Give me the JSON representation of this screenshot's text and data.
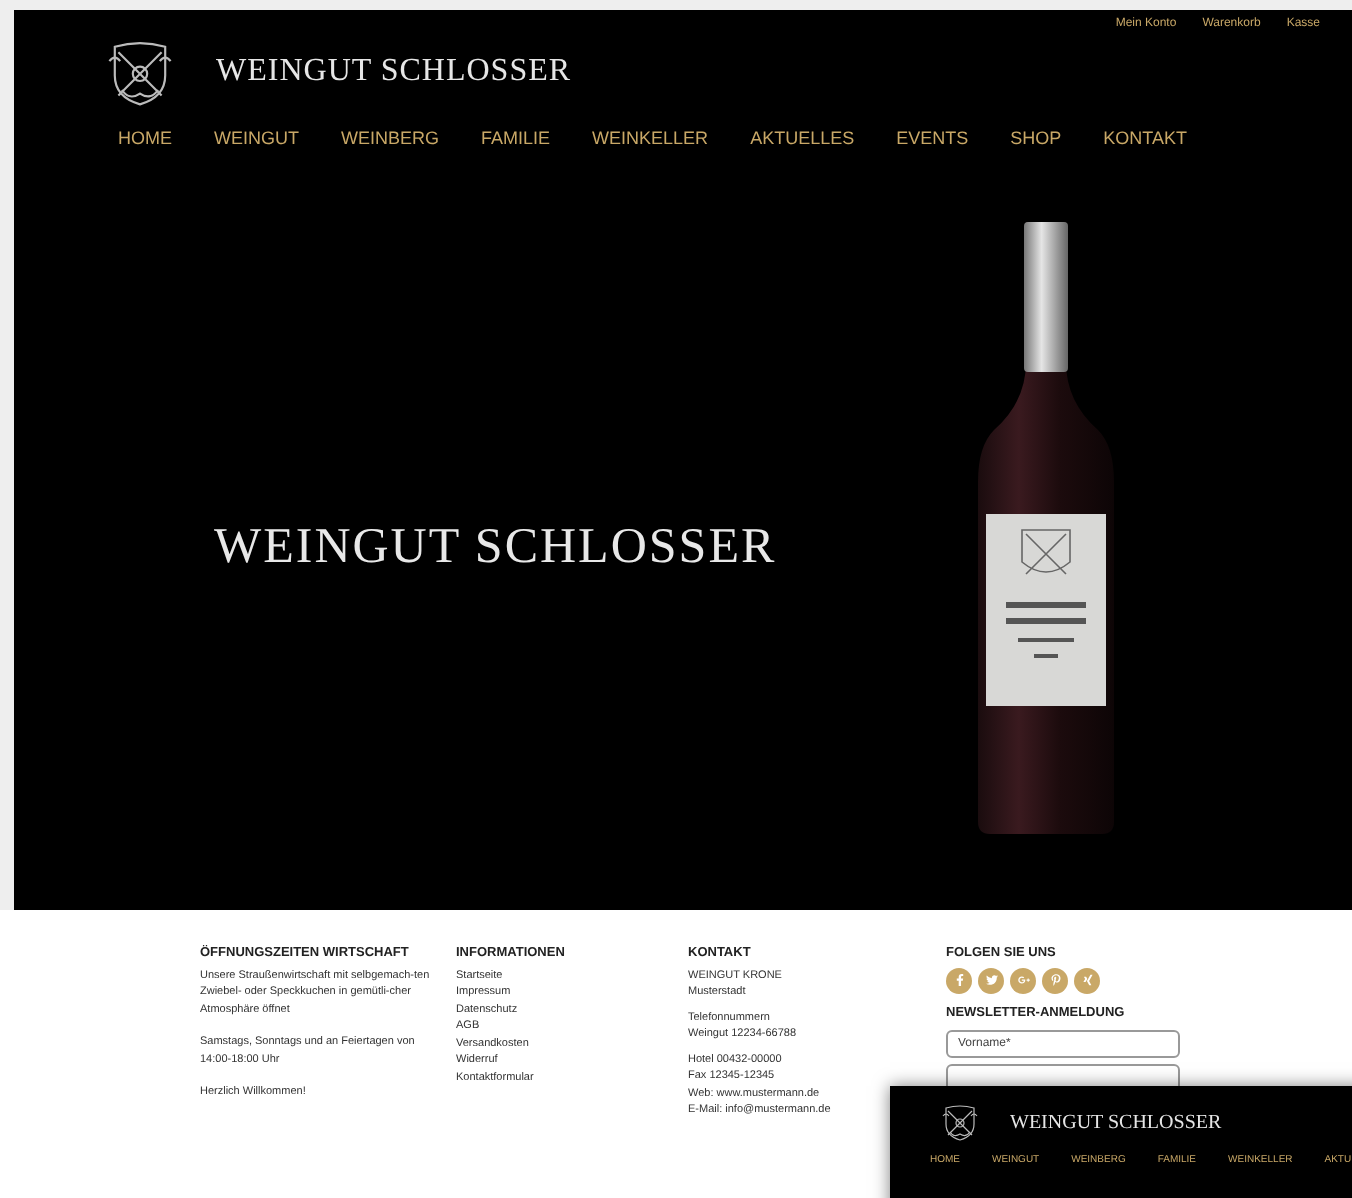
{
  "top_links": [
    "Mein Konto",
    "Warenkorb",
    "Kasse"
  ],
  "brand": "WEINGUT SCHLOSSER",
  "nav": [
    {
      "label": "HOME"
    },
    {
      "label": "WEINGUT"
    },
    {
      "label": "WEINBERG"
    },
    {
      "label": "FAMILIE"
    },
    {
      "label": "WEINKELLER"
    },
    {
      "label": "AKTUELLES"
    },
    {
      "label": "EVENTS"
    },
    {
      "label": "SHOP"
    },
    {
      "label": "KONTAKT"
    }
  ],
  "hero": {
    "title": "WEINGUT SCHLOSSER"
  },
  "footer": {
    "hours": {
      "heading": "ÖFFNUNGSZEITEN WIRTSCHAFT",
      "paragraphs": [
        "Unsere Straußenwirtschaft mit selbgemach-ten Zwiebel- oder Speckkuchen in gemütli-cher Atmosphäre öffnet",
        "Samstags, Sonntags und an Feiertagen von 14:00-18:00 Uhr",
        "Herzlich Willkommen!"
      ]
    },
    "info": {
      "heading": "INFORMATIONEN",
      "links": [
        "Startseite",
        "Impressum",
        "Datenschutz",
        "AGB",
        "Versandkosten",
        "Widerruf",
        "Kontaktformular"
      ]
    },
    "contact": {
      "heading": "KONTAKT",
      "groups": [
        [
          "WEINGUT KRONE",
          "Musterstadt"
        ],
        [
          "Telefonnummern",
          "Weingut 12234-66788"
        ],
        [
          "Hotel 00432-00000",
          "Fax 12345-12345",
          "Web: www.mustermann.de",
          "E-Mail: info@mustermann.de"
        ]
      ]
    },
    "social": {
      "heading": "FOLGEN SIE UNS"
    },
    "newsletter": {
      "heading": "NEWSLETTER-ANMELDUNG",
      "fields": [
        {
          "kind": "text",
          "placeholder": "Vorname*"
        },
        {
          "kind": "text"
        }
      ]
    }
  },
  "sticky_header": {
    "brand": "WEINGUT SCHLOSSER",
    "nav": [
      "HOME",
      "WEINGUT",
      "WEINBERG",
      "FAMILIE",
      "WEINKELLER",
      "AKTU"
    ]
  }
}
